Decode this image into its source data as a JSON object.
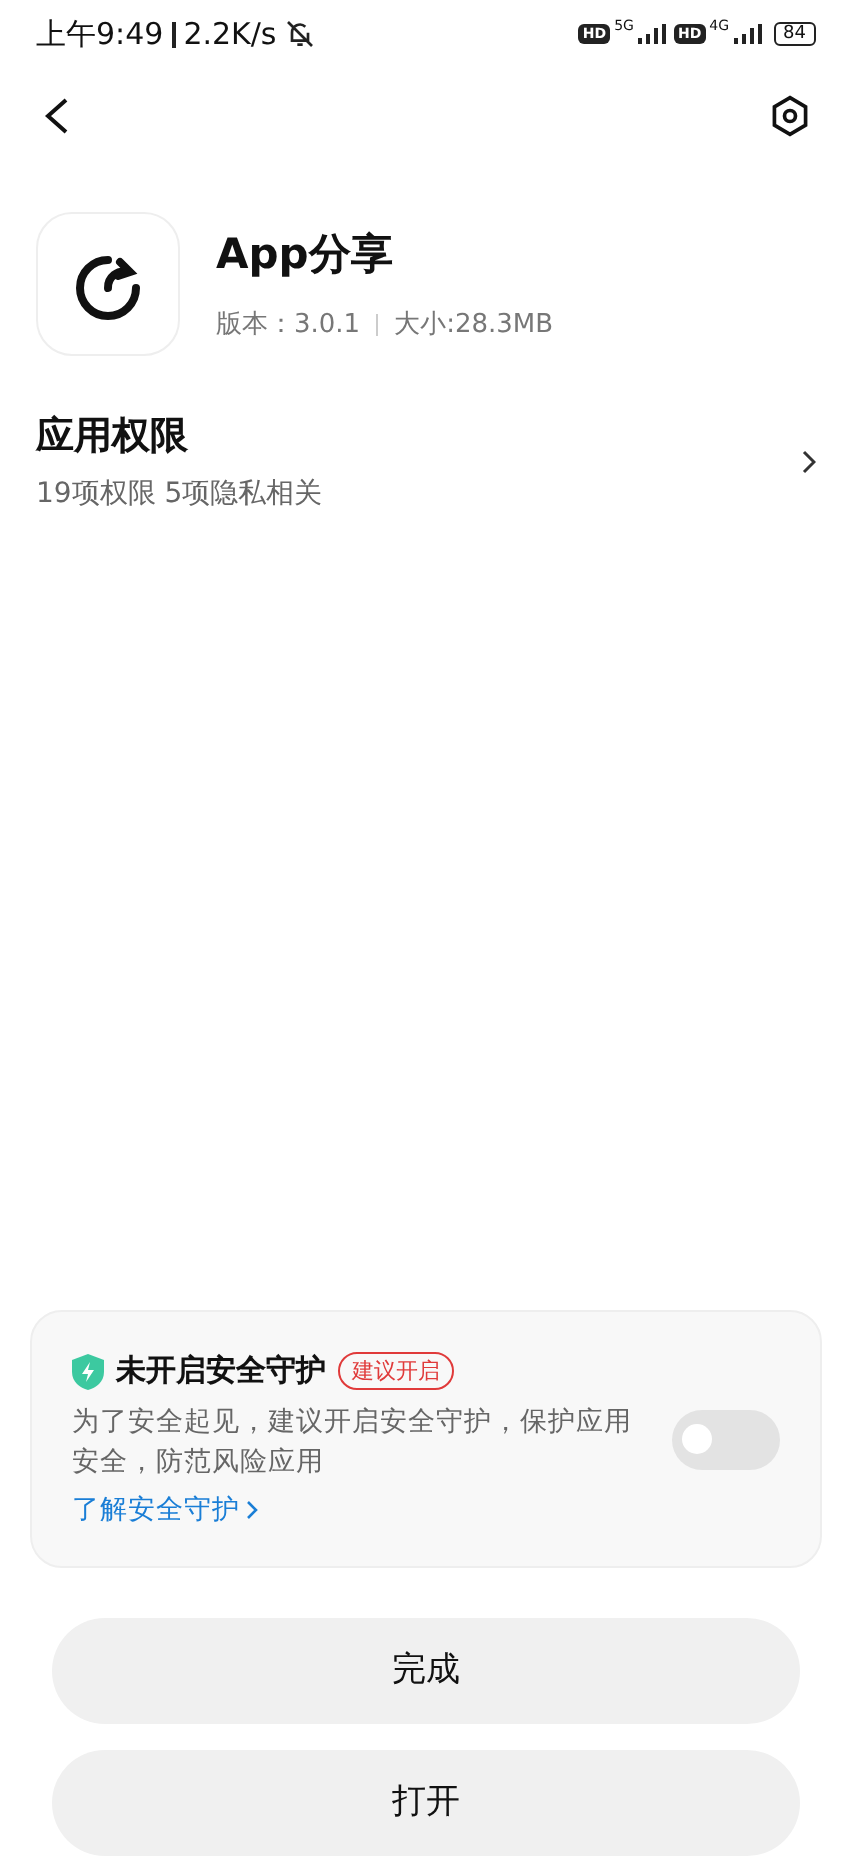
{
  "status_bar": {
    "time": "上午9:49",
    "speed": "2.2K/s",
    "sims": [
      {
        "hd": "HD",
        "network": "5G"
      },
      {
        "hd": "HD",
        "network": "4G"
      }
    ],
    "battery": "84"
  },
  "app": {
    "name": "App分享",
    "version": "版本：3.0.1",
    "size": "大小:28.3MB"
  },
  "permissions": {
    "title": "应用权限",
    "summary": "19项权限 5项隐私相关"
  },
  "security": {
    "title": "未开启安全守护",
    "badge": "建议开启",
    "description": "为了安全起见，建议开启安全守护，保护应用安全，防范风险应用",
    "link": "了解安全守护",
    "on": false
  },
  "buttons": [
    "完成",
    "打开"
  ]
}
